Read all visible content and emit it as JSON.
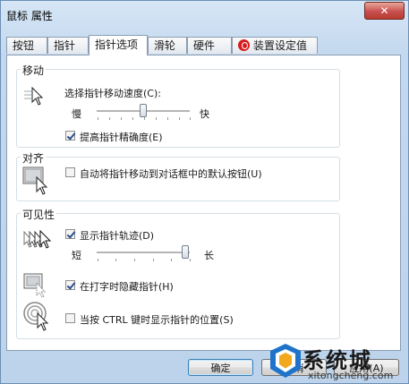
{
  "window": {
    "title": "鼠标 属性",
    "close_glyph": "✕"
  },
  "tabs": [
    {
      "label": "按钮"
    },
    {
      "label": "指针"
    },
    {
      "label": "指针选项"
    },
    {
      "label": "滑轮"
    },
    {
      "label": "硬件"
    },
    {
      "label": "装置设定值"
    }
  ],
  "motion": {
    "title": "移动",
    "speed_label": "选择指针移动速度(C):",
    "slow": "慢",
    "fast": "快",
    "speed_level": 0.5,
    "precision_label": "提高指针精确度(E)",
    "precision_checked": true
  },
  "snap": {
    "title": "对齐",
    "label": "自动将指针移动到对话框中的默认按钮(U)",
    "checked": false
  },
  "visibility": {
    "title": "可见性",
    "trails_label": "显示指针轨迹(D)",
    "trails_checked": true,
    "short": "短",
    "long": "长",
    "trails_level": 0.95,
    "hide_label": "在打字时隐藏指针(H)",
    "hide_checked": true,
    "ctrl_label": "当按 CTRL 键时显示指针的位置(S)",
    "ctrl_checked": false
  },
  "buttons": {
    "ok": "确定",
    "cancel": "取消",
    "apply": "应用(A)"
  },
  "watermark": {
    "brand": "系统城",
    "site": "xitongcheng.com"
  },
  "icons": {
    "motion": "pointer-speed-icon",
    "snap": "snap-to-icon",
    "trails": "pointer-trails-icon",
    "hide": "hide-pointer-icon",
    "ctrl": "show-location-icon"
  }
}
